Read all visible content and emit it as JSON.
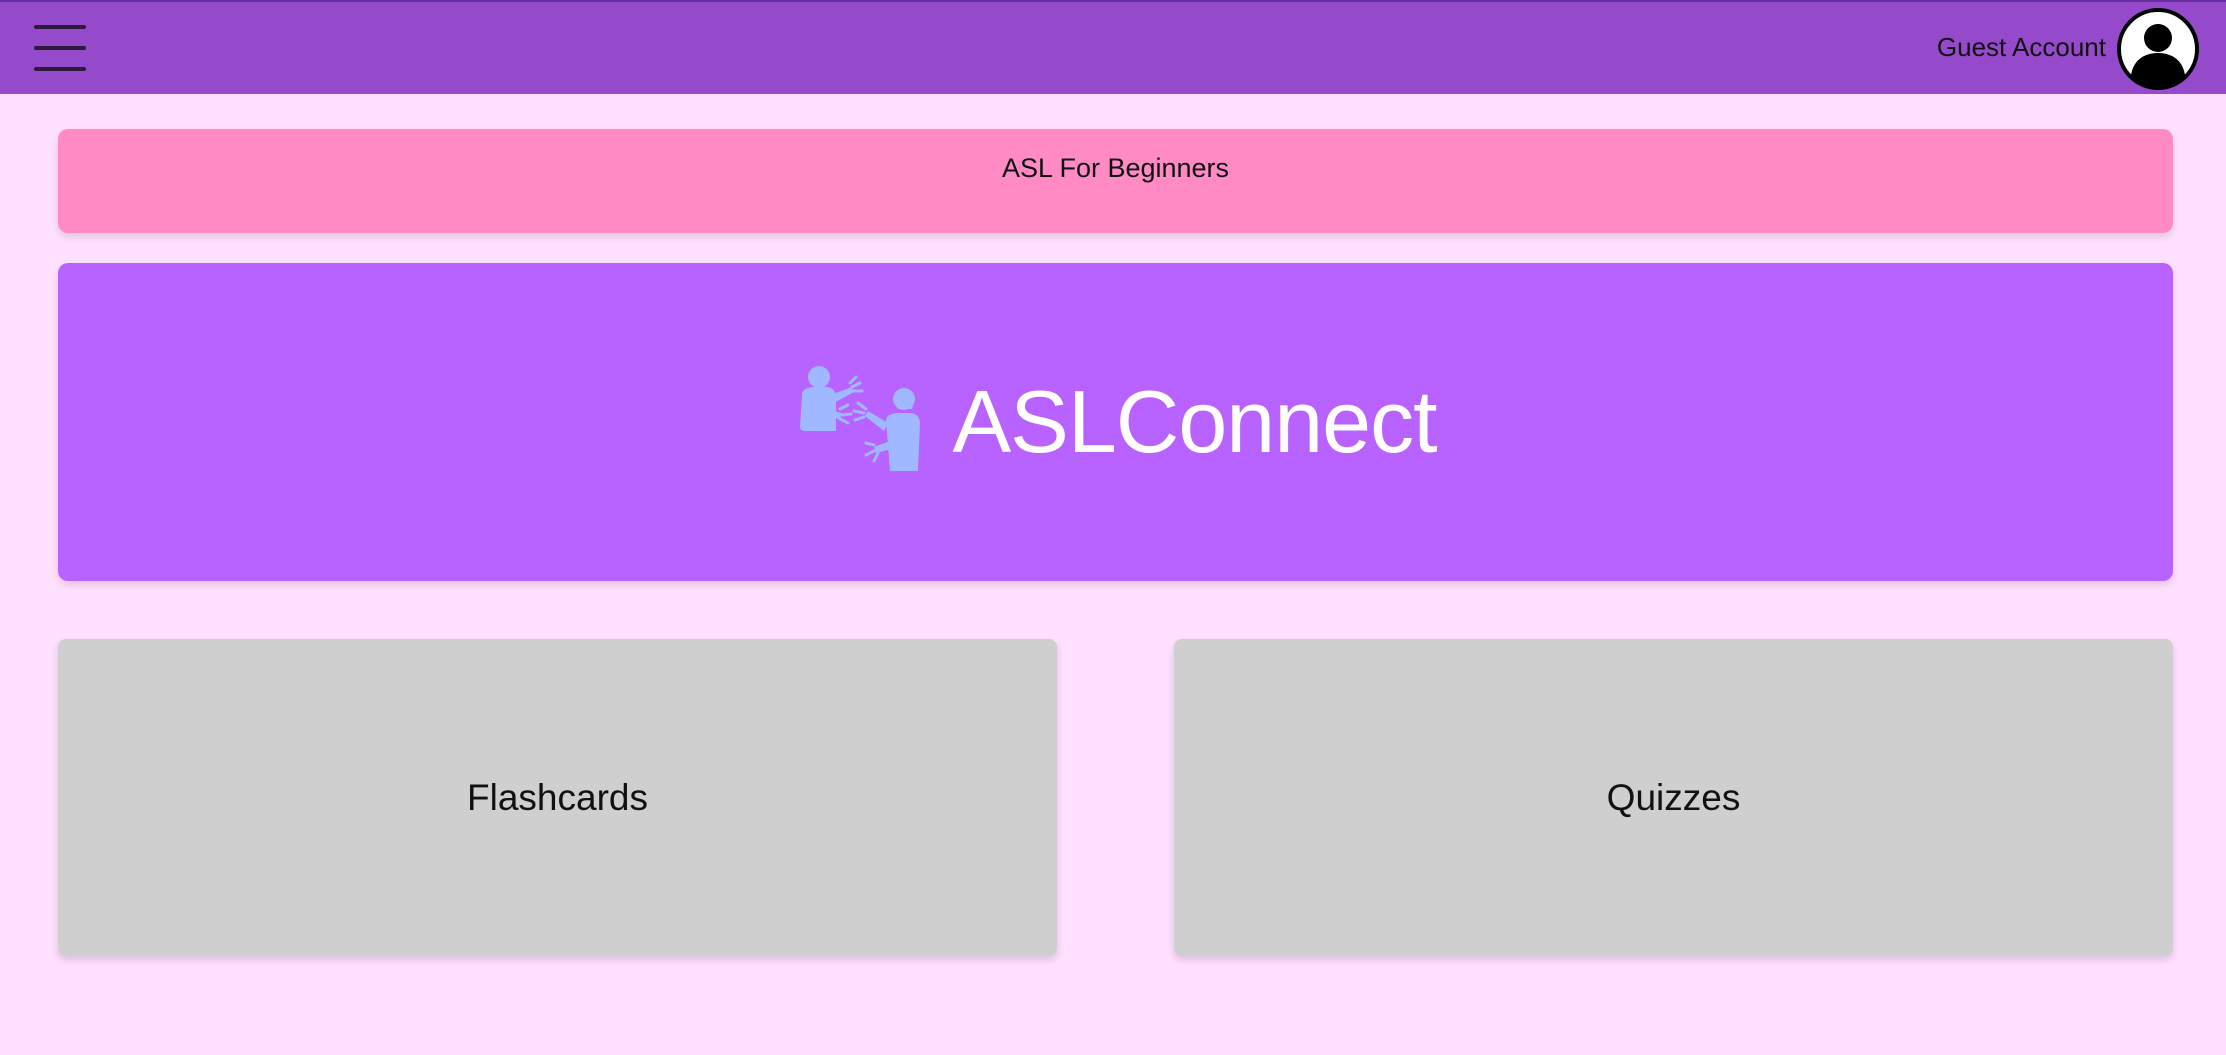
{
  "header": {
    "menu_icon": "hamburger-menu-icon",
    "account_label": "Guest Account",
    "avatar_icon": "user-avatar-icon"
  },
  "banner": {
    "subtitle": "ASL For Beginners"
  },
  "hero": {
    "logo_icon": "people-signing-icon",
    "brand": "ASLConnect"
  },
  "cards": [
    {
      "label": "Flashcards"
    },
    {
      "label": "Quizzes"
    }
  ],
  "colors": {
    "page_background": "#ffe0ff",
    "topbar": "#9549cb",
    "banner": "#ff8ac4",
    "hero": "#b862ff",
    "card": "#cfcfcf",
    "icon_blue": "#9fb8ff"
  }
}
